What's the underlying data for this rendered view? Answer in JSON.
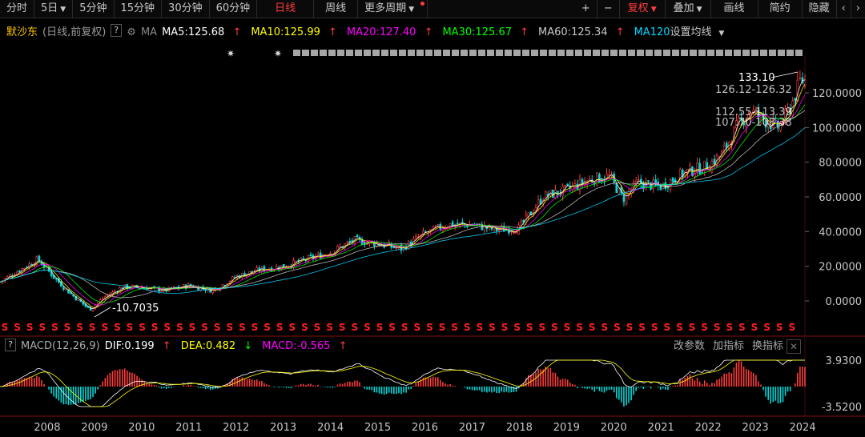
{
  "toolbar": {
    "items": [
      "分时",
      "5日",
      "5分钟",
      "15分钟",
      "30分钟",
      "60分钟",
      "日线",
      "周线",
      "更多周期",
      "+",
      "−",
      "复权",
      "叠加",
      "画线",
      "简约",
      "隐藏"
    ],
    "active": "日线",
    "nav_left": "‹",
    "nav_right": "›"
  },
  "legend": {
    "stock": "默沙东",
    "mode": "(日线,前复权)",
    "help": "?",
    "ma_label": "MA",
    "ma5": "MA5:125.68",
    "ma10": "MA10:125.99",
    "ma20": "MA20:127.40",
    "ma30": "MA30:125.67",
    "ma60": "MA60:125.34",
    "ma120": "MA120",
    "settings": "设置均线"
  },
  "macd": {
    "help": "?",
    "name": "MACD(12,26,9)",
    "dif": "DIF:0.199",
    "dea": "DEA:0.482",
    "macd": "MACD:-0.565",
    "tools": [
      "改参数",
      "加指标",
      "换指标"
    ],
    "ytop": "3.9300",
    "ybottom": "-3.5200"
  },
  "colors": {
    "up": "#ff3c3c",
    "down": "#00d8d8",
    "ma5": "#ffffff",
    "ma10": "#ffff00",
    "ma20": "#ff00ff",
    "ma30": "#00ff00",
    "ma60": "#c8c8c8",
    "ma120": "#00d8ff"
  },
  "chart_data": {
    "type": "line",
    "title": "默沙东",
    "ylim": [
      -4,
      136
    ],
    "yticks": [
      "120.0000",
      "100.0000",
      "80.0000",
      "60.0000",
      "40.0000",
      "20.0000",
      "0.0000"
    ],
    "ytick_values": [
      120,
      100,
      80,
      60,
      40,
      20,
      0
    ],
    "xticks": [
      "2008",
      "2009",
      "2010",
      "2011",
      "2012",
      "2013",
      "2014",
      "2015",
      "2016",
      "2017",
      "2018",
      "2019",
      "2020",
      "2021",
      "2022",
      "2023",
      "2024"
    ],
    "x": [
      2007.0,
      2007.8,
      2008.2,
      2008.5,
      2008.9,
      2009.2,
      2009.6,
      2010.0,
      2010.5,
      2011.0,
      2011.5,
      2012.0,
      2012.5,
      2013.0,
      2013.5,
      2014.0,
      2014.5,
      2015.0,
      2015.5,
      2016.0,
      2016.5,
      2017.0,
      2017.5,
      2018.0,
      2018.5,
      2019.0,
      2019.5,
      2019.9,
      2020.2,
      2020.5,
      2021.0,
      2021.5,
      2022.0,
      2022.3,
      2022.6,
      2022.9,
      2023.2,
      2023.5,
      2023.75,
      2023.95
    ],
    "series": [
      {
        "values": [
          11,
          24,
          12,
          4,
          -5,
          2,
          8,
          8,
          6,
          9,
          6,
          14,
          18,
          20,
          24,
          28,
          35,
          33,
          30,
          39,
          44,
          44,
          41,
          42,
          60,
          64,
          70,
          72,
          59,
          68,
          66,
          74,
          78,
          85,
          100,
          110,
          104,
          100,
          112,
          127
        ]
      }
    ],
    "annotations": [
      "133.10",
      "126.12-126.32",
      "112.55-113.39",
      "107.70-108.38",
      "-10.7035"
    ]
  }
}
